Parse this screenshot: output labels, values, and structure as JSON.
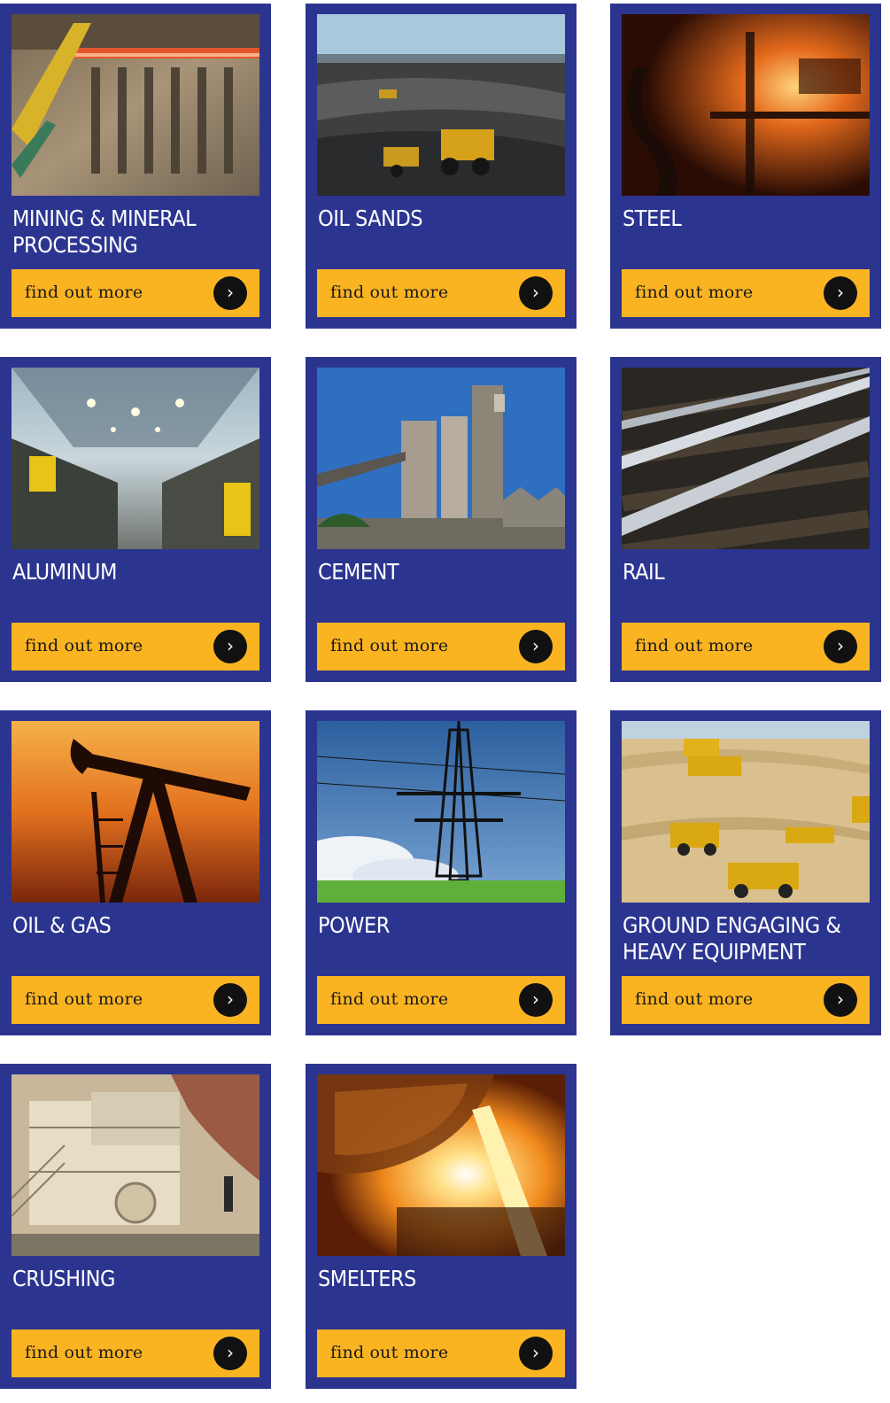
{
  "colors": {
    "card_background": "#2b3590",
    "button_background": "#fbb421",
    "arrow_background": "#111111",
    "title_text": "#ffffff"
  },
  "cta_label": "find out more",
  "arrow_icon": "chevron-right-icon",
  "cards": [
    {
      "title": "MINING & MINERAL\nPROCESSING",
      "image": "mining-furnace-image"
    },
    {
      "title": "OIL SANDS",
      "image": "oil-sands-mine-image"
    },
    {
      "title": "STEEL",
      "image": "steel-mill-image"
    },
    {
      "title": "ALUMINUM",
      "image": "aluminum-smelter-hall-image"
    },
    {
      "title": "CEMENT",
      "image": "cement-plant-image"
    },
    {
      "title": "RAIL",
      "image": "rail-tracks-image"
    },
    {
      "title": "OIL & GAS",
      "image": "oil-pumpjack-image"
    },
    {
      "title": "POWER",
      "image": "power-pylon-image"
    },
    {
      "title": "GROUND ENGAGING &\nHEAVY EQUIPMENT",
      "image": "haul-trucks-image"
    },
    {
      "title": "CRUSHING",
      "image": "crusher-plant-image"
    },
    {
      "title": "SMELTERS",
      "image": "molten-metal-pour-image"
    }
  ]
}
